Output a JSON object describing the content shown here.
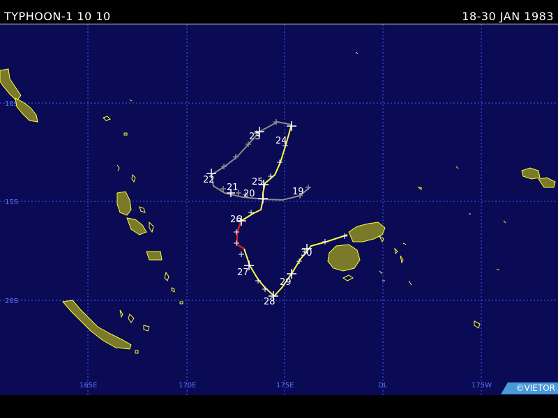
{
  "header": {
    "storm_name": "TYPHOON-1 10 10",
    "date_range": "18-30 JAN 1983"
  },
  "credit": "©VIETOR",
  "grid": {
    "lat_labels": [
      "10S",
      "15S",
      "20S"
    ],
    "lon_labels": [
      "165E",
      "170E",
      "175E",
      "DL",
      "175W"
    ]
  },
  "track": {
    "day_labels": [
      "19",
      "20",
      "21",
      "22",
      "23",
      "24",
      "25",
      "26",
      "27",
      "28",
      "29",
      "30"
    ]
  },
  "colors": {
    "ocean": "#0a0a55",
    "land_fill": "#7a7a2a",
    "coastline": "#ffff33",
    "grid": "#4060ff",
    "track_weak": "#8c8c8c",
    "track_storm": "#ffff40",
    "track_intense": "#c82020"
  }
}
